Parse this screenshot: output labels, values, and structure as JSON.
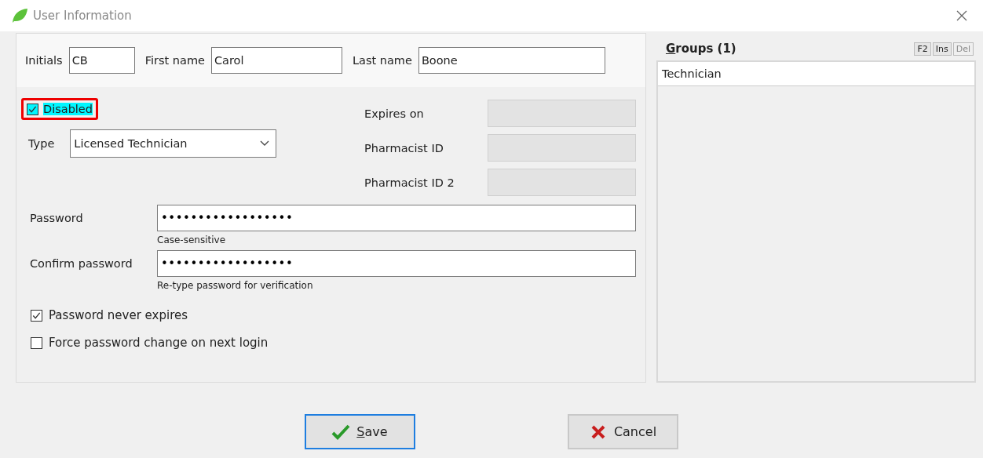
{
  "window": {
    "title": "User Information"
  },
  "name_fields": [
    {
      "label": "Initials",
      "value": "CB"
    },
    {
      "label": "First name",
      "value": "Carol"
    },
    {
      "label": "Last name",
      "value": "Boone"
    }
  ],
  "disabled_checkbox": {
    "label": "Disabled",
    "checked": true,
    "highlighted": true
  },
  "type_select": {
    "label": "Type",
    "value": "Licensed Technician"
  },
  "readonly_fields": [
    {
      "label": "Expires on"
    },
    {
      "label": "Pharmacist ID"
    },
    {
      "label": "Pharmacist ID 2"
    }
  ],
  "password_fields": [
    {
      "label": "Password",
      "value": "••••••••••••••••••",
      "hint": "Case-sensitive"
    },
    {
      "label": "Confirm password",
      "value": "••••••••••••••••••",
      "hint": "Re-type password for verification"
    }
  ],
  "options": [
    {
      "label": "Password never expires",
      "checked": true
    },
    {
      "label": "Force password change on next login",
      "checked": false
    }
  ],
  "groups": {
    "title": "Groups (1)",
    "tools": [
      {
        "label": "F2",
        "disabled": false
      },
      {
        "label": "Ins",
        "disabled": false
      },
      {
        "label": "Del",
        "disabled": true
      }
    ],
    "items": [
      {
        "label": "Technician",
        "selected": true
      }
    ]
  },
  "buttons": [
    {
      "label": "Save",
      "kind": "save",
      "focused": true
    },
    {
      "label": "Cancel",
      "kind": "cancel",
      "focused": false
    }
  ]
}
